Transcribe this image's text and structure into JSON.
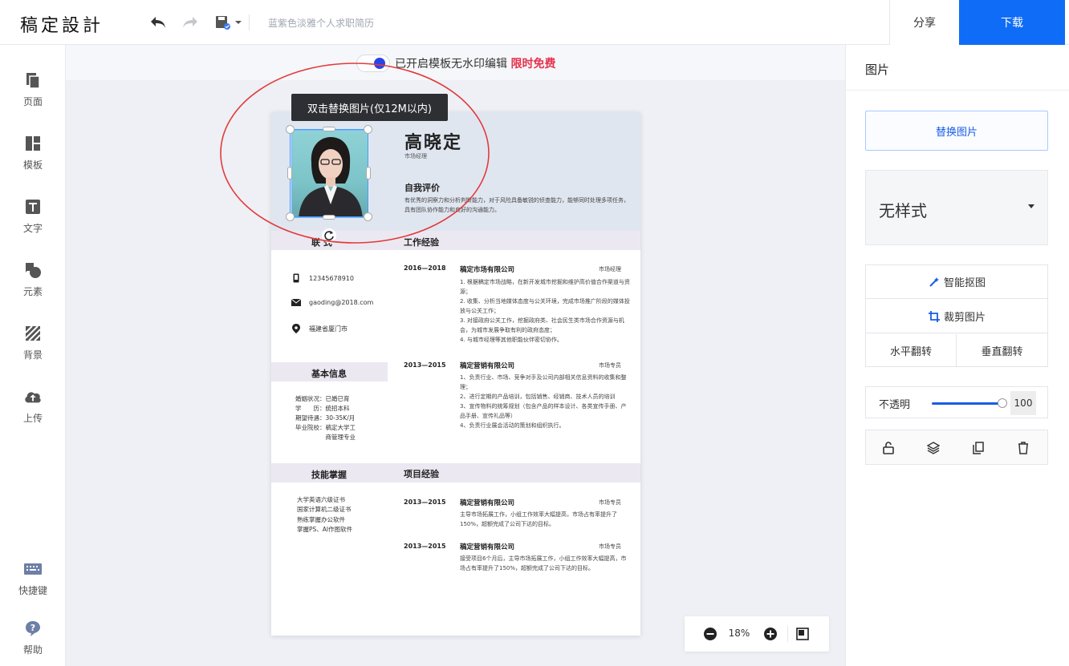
{
  "header": {
    "logo": "稿定設計",
    "doc_title": "蓝紫色淡雅个人求职简历",
    "share_label": "分享",
    "download_label": "下载"
  },
  "sidebar": {
    "items": [
      {
        "label": "页面",
        "icon": "pages-icon"
      },
      {
        "label": "模板",
        "icon": "template-icon"
      },
      {
        "label": "文字",
        "icon": "text-icon"
      },
      {
        "label": "元素",
        "icon": "elements-icon"
      },
      {
        "label": "背景",
        "icon": "background-icon"
      },
      {
        "label": "上传",
        "icon": "upload-icon"
      }
    ],
    "shortcut_label": "快捷键",
    "help_label": "帮助"
  },
  "canvas": {
    "watermark_text": "已开启模板无水印编辑",
    "watermark_free": "限时免费",
    "tooltip": "双击替换图片(仅12M以内)",
    "zoom": "18%"
  },
  "resume": {
    "name": "高晓定",
    "role": "市场经理",
    "self_title": "自我评价",
    "self_text": "有优秀的洞察力和分析判断能力，对于风险具备敏锐的侦查能力，能够同时处理多项任务，具有团队协作能力和良好的沟通能力。",
    "contact_title": "联系方式",
    "contact_visible": "联  式",
    "phone": "12345678910",
    "email": "gaoding@2018.com",
    "address": "福建省厦门市",
    "basic_title": "基本信息",
    "basic": [
      "婚姻状况：已婚已育",
      "学　　历：统招本科",
      "期望待遇：30-35K/月",
      "毕业院校：稿定大学工",
      "　　　　　商管理专业"
    ],
    "skills_title": "技能掌握",
    "skills": [
      "大学英语六级证书",
      "国家计算机二级证书",
      "熟练掌握办公软件",
      "掌握PS、AI作图软件"
    ],
    "work_title": "工作经验",
    "jobs": [
      {
        "date": "2016—2018",
        "company": "稿定市场有限公司",
        "position": "市场经理",
        "desc": "1. 根据稿定市场战略，在新开发城市挖掘和维护高价值合作渠道与资源；\n2. 收集、分析当地媒体态度与公关环境，完成市场推广阶段的媒体投放与公关工作；\n3. 对接政府公关工作，挖掘政府类、社会民生类市场合作资源与机会，为城市发展争取有利的政府态度；\n4. 与城市经理等其他职能伙伴密切协作。"
      },
      {
        "date": "2013—2015",
        "company": "稿定营销有限公司",
        "position": "市场专员",
        "desc": "1、负责行业、市场、竞争对手及公司内部相关信息资料的收集和整理；\n2、进行定期的产品培训，包括销售、经销商、技术人员的培训\n3、宣传物料的统筹规划（包含产品的样本设计、各类宣传手册、产品手册、宣传礼品等）\n4、负责行业展会活动的策划和组织执行。"
      }
    ],
    "project_title": "项目经验",
    "projects": [
      {
        "date": "2013—2015",
        "company": "稿定营销有限公司",
        "position": "市场专员",
        "desc": "主导市场拓展工作，小组工作效率大幅提高，市场占有率提升了150%，超额完成了公司下达的目标。"
      },
      {
        "date": "2013—2015",
        "company": "稿定营销有限公司",
        "position": "市场专员",
        "desc": "接受项目6个月后，主导市场拓展工作，小组工作效率大幅提高，市场占有率提升了150%，超额完成了公司下达的目标。"
      }
    ]
  },
  "panel": {
    "title": "图片",
    "replace_label": "替换图片",
    "style_value": "无样式",
    "smart_cutout": "智能抠图",
    "crop": "裁剪图片",
    "flip_h": "水平翻转",
    "flip_v": "垂直翻转",
    "opacity_label": "不透明",
    "opacity_value": "100"
  },
  "colors": {
    "accent": "#0f6cf6",
    "free_red": "#e6314c"
  }
}
